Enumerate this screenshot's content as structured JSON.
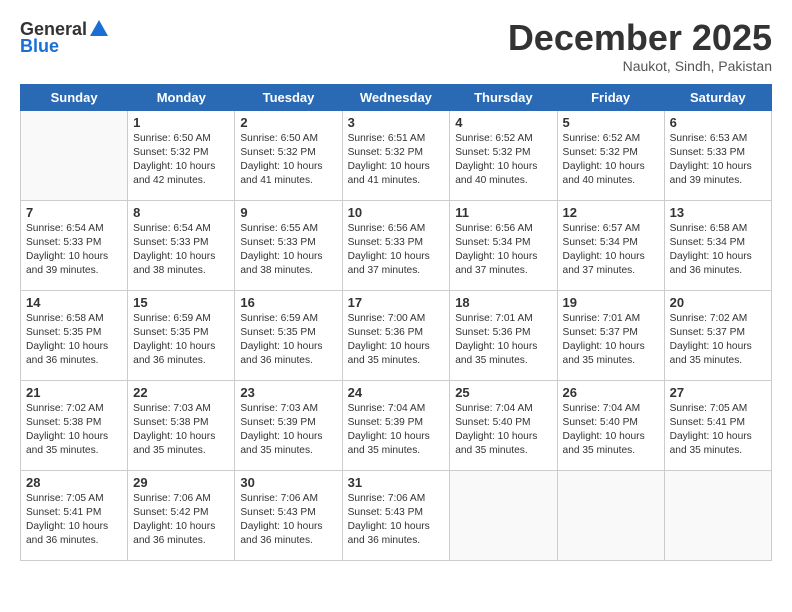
{
  "logo": {
    "general": "General",
    "blue": "Blue"
  },
  "header": {
    "month": "December 2025",
    "location": "Naukot, Sindh, Pakistan"
  },
  "weekdays": [
    "Sunday",
    "Monday",
    "Tuesday",
    "Wednesday",
    "Thursday",
    "Friday",
    "Saturday"
  ],
  "weeks": [
    [
      {
        "day": "",
        "empty": true
      },
      {
        "day": "1",
        "sunrise": "6:50 AM",
        "sunset": "5:32 PM",
        "daylight": "10 hours and 42 minutes."
      },
      {
        "day": "2",
        "sunrise": "6:50 AM",
        "sunset": "5:32 PM",
        "daylight": "10 hours and 41 minutes."
      },
      {
        "day": "3",
        "sunrise": "6:51 AM",
        "sunset": "5:32 PM",
        "daylight": "10 hours and 41 minutes."
      },
      {
        "day": "4",
        "sunrise": "6:52 AM",
        "sunset": "5:32 PM",
        "daylight": "10 hours and 40 minutes."
      },
      {
        "day": "5",
        "sunrise": "6:52 AM",
        "sunset": "5:32 PM",
        "daylight": "10 hours and 40 minutes."
      },
      {
        "day": "6",
        "sunrise": "6:53 AM",
        "sunset": "5:33 PM",
        "daylight": "10 hours and 39 minutes."
      }
    ],
    [
      {
        "day": "7",
        "sunrise": "6:54 AM",
        "sunset": "5:33 PM",
        "daylight": "10 hours and 39 minutes."
      },
      {
        "day": "8",
        "sunrise": "6:54 AM",
        "sunset": "5:33 PM",
        "daylight": "10 hours and 38 minutes."
      },
      {
        "day": "9",
        "sunrise": "6:55 AM",
        "sunset": "5:33 PM",
        "daylight": "10 hours and 38 minutes."
      },
      {
        "day": "10",
        "sunrise": "6:56 AM",
        "sunset": "5:33 PM",
        "daylight": "10 hours and 37 minutes."
      },
      {
        "day": "11",
        "sunrise": "6:56 AM",
        "sunset": "5:34 PM",
        "daylight": "10 hours and 37 minutes."
      },
      {
        "day": "12",
        "sunrise": "6:57 AM",
        "sunset": "5:34 PM",
        "daylight": "10 hours and 37 minutes."
      },
      {
        "day": "13",
        "sunrise": "6:58 AM",
        "sunset": "5:34 PM",
        "daylight": "10 hours and 36 minutes."
      }
    ],
    [
      {
        "day": "14",
        "sunrise": "6:58 AM",
        "sunset": "5:35 PM",
        "daylight": "10 hours and 36 minutes."
      },
      {
        "day": "15",
        "sunrise": "6:59 AM",
        "sunset": "5:35 PM",
        "daylight": "10 hours and 36 minutes."
      },
      {
        "day": "16",
        "sunrise": "6:59 AM",
        "sunset": "5:35 PM",
        "daylight": "10 hours and 36 minutes."
      },
      {
        "day": "17",
        "sunrise": "7:00 AM",
        "sunset": "5:36 PM",
        "daylight": "10 hours and 35 minutes."
      },
      {
        "day": "18",
        "sunrise": "7:01 AM",
        "sunset": "5:36 PM",
        "daylight": "10 hours and 35 minutes."
      },
      {
        "day": "19",
        "sunrise": "7:01 AM",
        "sunset": "5:37 PM",
        "daylight": "10 hours and 35 minutes."
      },
      {
        "day": "20",
        "sunrise": "7:02 AM",
        "sunset": "5:37 PM",
        "daylight": "10 hours and 35 minutes."
      }
    ],
    [
      {
        "day": "21",
        "sunrise": "7:02 AM",
        "sunset": "5:38 PM",
        "daylight": "10 hours and 35 minutes."
      },
      {
        "day": "22",
        "sunrise": "7:03 AM",
        "sunset": "5:38 PM",
        "daylight": "10 hours and 35 minutes."
      },
      {
        "day": "23",
        "sunrise": "7:03 AM",
        "sunset": "5:39 PM",
        "daylight": "10 hours and 35 minutes."
      },
      {
        "day": "24",
        "sunrise": "7:04 AM",
        "sunset": "5:39 PM",
        "daylight": "10 hours and 35 minutes."
      },
      {
        "day": "25",
        "sunrise": "7:04 AM",
        "sunset": "5:40 PM",
        "daylight": "10 hours and 35 minutes."
      },
      {
        "day": "26",
        "sunrise": "7:04 AM",
        "sunset": "5:40 PM",
        "daylight": "10 hours and 35 minutes."
      },
      {
        "day": "27",
        "sunrise": "7:05 AM",
        "sunset": "5:41 PM",
        "daylight": "10 hours and 35 minutes."
      }
    ],
    [
      {
        "day": "28",
        "sunrise": "7:05 AM",
        "sunset": "5:41 PM",
        "daylight": "10 hours and 36 minutes."
      },
      {
        "day": "29",
        "sunrise": "7:06 AM",
        "sunset": "5:42 PM",
        "daylight": "10 hours and 36 minutes."
      },
      {
        "day": "30",
        "sunrise": "7:06 AM",
        "sunset": "5:43 PM",
        "daylight": "10 hours and 36 minutes."
      },
      {
        "day": "31",
        "sunrise": "7:06 AM",
        "sunset": "5:43 PM",
        "daylight": "10 hours and 36 minutes."
      },
      {
        "day": "",
        "empty": true
      },
      {
        "day": "",
        "empty": true
      },
      {
        "day": "",
        "empty": true
      }
    ]
  ]
}
